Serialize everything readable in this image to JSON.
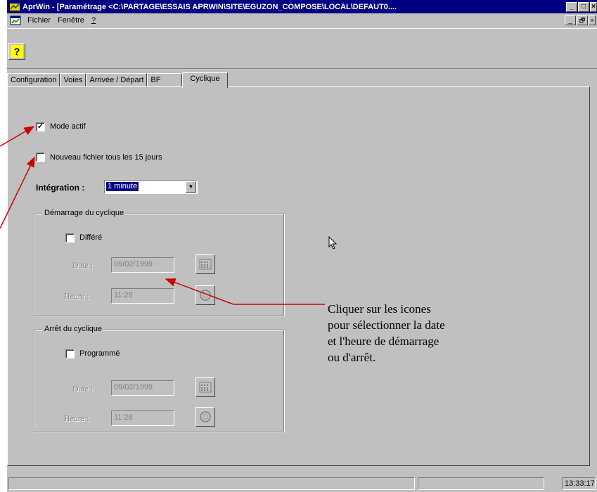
{
  "window": {
    "title": "AprWin - [Paramétrage  <C:\\PARTAGE\\ESSAIS APRWIN\\SITE\\EGUZON_COMPOSE\\LOCAL\\DEFAUT0....",
    "app_icon": "aprwin-app-icon",
    "controls": [
      "minimize",
      "maximize",
      "close"
    ]
  },
  "menu": {
    "items": [
      "Fichier",
      "Fenêtre",
      "?"
    ],
    "mdi_controls": [
      "_",
      "🗗",
      "×"
    ]
  },
  "toolbar": {
    "help_label": "?",
    "help_icon": "help-icon"
  },
  "tabs": [
    "Configuration",
    "Voies",
    "Arrivée / Départ",
    "BF",
    "Cyclique"
  ],
  "active_tab": "Cyclique",
  "form": {
    "mode_actif": {
      "label": "Mode actif",
      "checked": true
    },
    "nouveau_fichier": {
      "label": "Nouveau fichier tous les 15 jours",
      "checked": false
    },
    "integration": {
      "label": "Intégration :",
      "value": "1 minute"
    },
    "demarrage": {
      "title": "Démarrage du cyclique",
      "differe": {
        "label": "Différé",
        "checked": false
      },
      "date_label": "Date :",
      "date_value": "09/02/1999",
      "heure_label": "Heure :",
      "heure_value": "11:28"
    },
    "arret": {
      "title": "Arrêt du cyclique",
      "programme": {
        "label": "Programmé",
        "checked": false
      },
      "date_label": "Date :",
      "date_value": "09/02/1999",
      "heure_label": "Heure :",
      "heure_value": "11:28"
    }
  },
  "annotation": {
    "lines": [
      "Cliquer sur les icones",
      "pour sélectionner la date",
      "et l'heure de démarrage",
      "ou d'arrêt."
    ]
  },
  "status": {
    "time": "13:33:17"
  },
  "colors": {
    "titlebar": "#000080",
    "face": "#c0c0c0",
    "arrow": "#cc0000",
    "selection": "#000080"
  }
}
